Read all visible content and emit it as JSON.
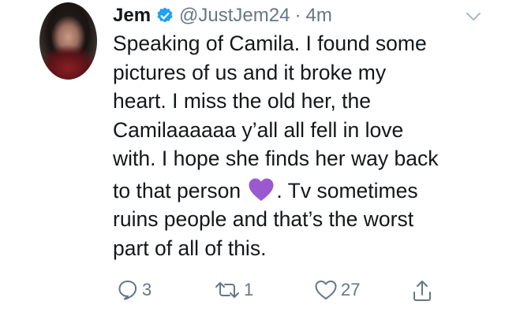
{
  "tweet": {
    "author_name": "Jem",
    "handle": "@JustJem24",
    "separator": "·",
    "time": "4m",
    "lines": [
      "Speaking of Camila. I found some",
      "pictures of us and it broke my",
      "heart. I miss the old her, the",
      "Camilaaaaaa y’all all fell in love",
      "with. I hope she finds her way back"
    ],
    "line6_before": "to that person ",
    "line6_after": ". Tv sometimes",
    "lines_tail": [
      "ruins people and that’s the worst",
      "part of all of this."
    ],
    "emoji": "purple-heart",
    "colors": {
      "accent": "#1da1f2",
      "muted": "#657786",
      "text": "#14171a",
      "emoji_purple": "#9b59d0"
    }
  },
  "actions": {
    "reply_count": "3",
    "retweet_count": "1",
    "like_count": "27",
    "share_label": ""
  }
}
